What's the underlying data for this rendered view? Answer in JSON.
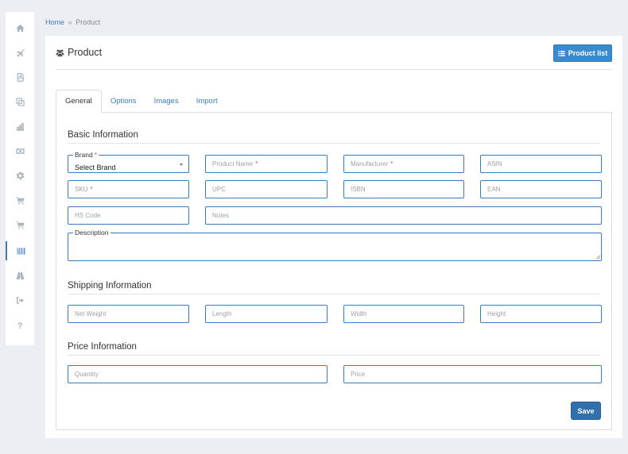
{
  "sidebar": {
    "items": [
      {
        "icon": "home-icon"
      },
      {
        "icon": "plane-icon"
      },
      {
        "icon": "pdf-file-icon"
      },
      {
        "icon": "copy-icon"
      },
      {
        "icon": "bar-chart-icon"
      },
      {
        "icon": "money-icon"
      },
      {
        "icon": "gear-icon"
      },
      {
        "icon": "cart-icon"
      },
      {
        "icon": "cart-icon"
      },
      {
        "icon": "barcode-icon",
        "active": true
      },
      {
        "icon": "road-icon"
      },
      {
        "icon": "sign-out-icon"
      },
      {
        "icon": "question-icon",
        "glyph": "?"
      }
    ]
  },
  "breadcrumb": {
    "home": "Home",
    "separator": "»",
    "current": "Product"
  },
  "header": {
    "title": "Product",
    "title_icon": "users-icon",
    "product_list_label": "Product list",
    "product_list_icon": "list-icon"
  },
  "tabs": [
    {
      "label": "General",
      "active": true
    },
    {
      "label": "Options"
    },
    {
      "label": "Images"
    },
    {
      "label": "Import"
    }
  ],
  "sections": {
    "basic": "Basic Information",
    "shipping": "Shipping Information",
    "price": "Price Information"
  },
  "fields": {
    "brand": {
      "label": "Brand",
      "value": "Select Brand",
      "required_mark": "*"
    },
    "product_name": {
      "placeholder": "Product Name",
      "required_mark": "*"
    },
    "manufacturer": {
      "placeholder": "Manufacturer",
      "required_mark": "*"
    },
    "asin": {
      "placeholder": "ASIN"
    },
    "sku": {
      "placeholder": "SKU",
      "required_mark": "*"
    },
    "upc": {
      "placeholder": "UPC"
    },
    "isbn": {
      "placeholder": "ISBN"
    },
    "ean": {
      "placeholder": "EAN"
    },
    "hs_code": {
      "placeholder": "HS Code"
    },
    "notes": {
      "placeholder": "Notes"
    },
    "description": {
      "label": "Description"
    },
    "net_weight": {
      "placeholder": "Net Weight"
    },
    "length": {
      "placeholder": "Length"
    },
    "width": {
      "placeholder": "Width"
    },
    "height": {
      "placeholder": "Height"
    },
    "quantity": {
      "placeholder": "Quantity"
    },
    "price": {
      "placeholder": "Price"
    }
  },
  "actions": {
    "save_label": "Save"
  },
  "colors": {
    "accent": "#3a7ebf",
    "button": "#3a8bcd",
    "save": "#2f70ad",
    "required": "#d9534f",
    "background": "#eceef4"
  }
}
